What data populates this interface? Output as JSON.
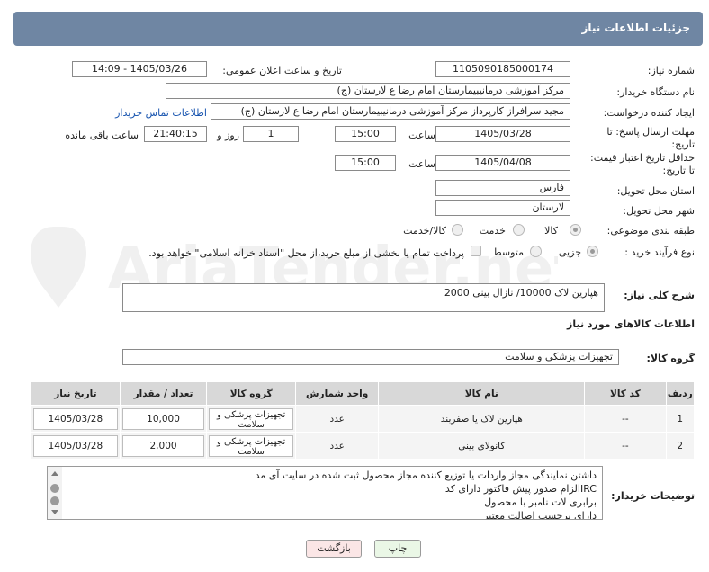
{
  "header": {
    "title": "جزئیات اطلاعات نیاز"
  },
  "form": {
    "need_number_label": "شماره نیاز:",
    "need_number": "1105090185000174",
    "announce_label": "تاریخ و ساعت اعلان عمومی:",
    "announce_value": "1405/03/26 - 14:09",
    "buyer_org_label": "نام دستگاه خریدار:",
    "buyer_org": "مرکز آموزشی  درمانیبیمارستان امام رضا  ع  لارستان (ج)",
    "creator_label": "ایجاد کننده درخواست:",
    "creator": "مجید سرافراز کارپرداز  مرکز آموزشی  درمانیبیمارستان امام رضا  ع  لارستان (ج)",
    "contact_link": "اطلاعات تماس خریدار",
    "deadline_label_1": "مهلت ارسال پاسخ: تا",
    "deadline_label_2": "تاریخ:",
    "deadline_date": "1405/03/28",
    "time_label": "ساعت",
    "deadline_time": "15:00",
    "days_value": "1",
    "days_label": "روز و",
    "remaining_time": "21:40:15",
    "remaining_label": "ساعت باقی مانده",
    "validity_label_1": "حداقل تاریخ اعتبار قیمت:",
    "validity_label_2": "تا تاریخ:",
    "validity_date": "1405/04/08",
    "validity_time": "15:00",
    "province_label": "استان محل تحویل:",
    "province": "فارس",
    "city_label": "شهر محل تحویل:",
    "city": "لارستان",
    "category_label": "طبقه بندی موضوعی:",
    "category_options": [
      "کالا",
      "خدمت",
      "کالا/خدمت"
    ],
    "category_selected": "کالا",
    "process_label": "نوع فرآیند خرید :",
    "process_options": [
      "جزیی",
      "متوسط"
    ],
    "process_selected": "جزیی",
    "payment_note": "پرداخت تمام یا بخشی از مبلغ خرید،از محل \"اسناد خزانه اسلامی\" خواهد بود.",
    "summary_label": "شرح کلی نیاز:",
    "summary": "هپارین لاک 10000/ نازال بینی 2000",
    "goods_info_label": "اطلاعات کالاهای مورد نیاز",
    "group_label": "گروه کالا:",
    "group_value": "تجهیزات پزشکی و سلامت"
  },
  "table": {
    "headers": [
      "ردیف",
      "کد کالا",
      "نام کالا",
      "واحد شمارش",
      "گروه کالا",
      "تعداد / مقدار",
      "تاریخ نیاز"
    ],
    "rows": [
      [
        "1",
        "--",
        "هپارین لاک یا صفربند",
        "عدد",
        "تجهیزات پزشکی و سلامت",
        "10,000",
        "1405/03/28"
      ],
      [
        "2",
        "--",
        "کانولای بینی",
        "عدد",
        "تجهیزات پزشکی و سلامت",
        "2,000",
        "1405/03/28"
      ]
    ]
  },
  "notes": {
    "label": "توضیحات خریدار:",
    "lines": [
      "داشتن نمایندگی مجاز واردات یا توزیع کننده مجاز محصول ثبت شده در سایت آی مد",
      "IRCالزام صدور پیش فاکتور دارای کد",
      "برابری لات نامبر با محصول",
      "دارای برچسب اصالت معتبر"
    ]
  },
  "buttons": {
    "print": "چاپ",
    "back": "بازگشت"
  },
  "watermark": {
    "text": "AriaTender.net"
  },
  "colors": {
    "title_bar": "#6f86a3",
    "print_button": "#eaf7e6",
    "back_button": "#fbe6e6",
    "link": "#1a56b0"
  }
}
